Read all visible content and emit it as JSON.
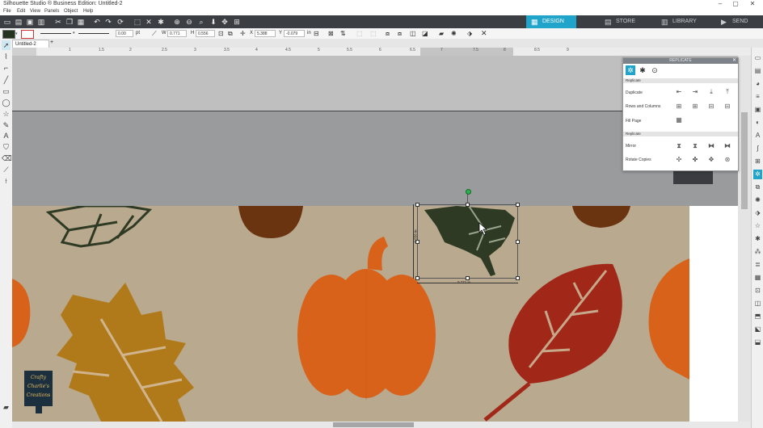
{
  "window": {
    "title": "Silhouette Studio ® Business Edition: Untitled-2",
    "controls": [
      "–",
      "▢",
      "✕"
    ]
  },
  "menu": [
    "File",
    "Edit",
    "View",
    "Panels",
    "Object",
    "Help"
  ],
  "nav_tabs": [
    {
      "label": "DESIGN",
      "icon": "design-icon",
      "active": true
    },
    {
      "label": "STORE",
      "icon": "store-icon",
      "active": false
    },
    {
      "label": "LIBRARY",
      "icon": "library-icon",
      "active": false
    },
    {
      "label": "SEND",
      "icon": "send-icon",
      "active": false
    }
  ],
  "property_bar": {
    "line_weight": "0.00",
    "line_unit": "pt",
    "w_label": "W",
    "w_value": "0.771",
    "h_label": "H",
    "h_value": "0.556",
    "x_label": "X",
    "x_value": "5.388",
    "y_label": "Y",
    "y_value": "-0.079",
    "unit": "in"
  },
  "document_tab": {
    "label": "Untitled-2",
    "add": "+"
  },
  "ruler_labels": [
    "1",
    "1.5",
    "2",
    "2.5",
    "3",
    "3.5",
    "4",
    "4.5",
    "5",
    "5.5",
    "6",
    "6.5",
    "7",
    "7.5",
    "8",
    "8.5",
    "9"
  ],
  "replicate_panel": {
    "title": "REPLICATE",
    "close": "✕",
    "section1": "Replicate",
    "rows1": [
      "Duplicate",
      "Rows and Columns",
      "Fill Page"
    ],
    "section2": "Replicate",
    "rows2": [
      "Mirror",
      "Rotate Copies"
    ]
  },
  "selection": {
    "width_label": "0.771 in",
    "height_label": "0.556 in"
  },
  "logo": {
    "line1": "Crafty",
    "line2": "Charlie's",
    "line3": "Creations"
  },
  "colors": {
    "accent": "#20a4c9",
    "toolbar": "#3b3f44",
    "mat": "#b9a98e",
    "leaf_dark": "#2e3a24",
    "leaf_gold": "#b07a1a",
    "pumpkin": "#d8621a",
    "leaf_red": "#a12718",
    "acorn": "#6b3410"
  }
}
